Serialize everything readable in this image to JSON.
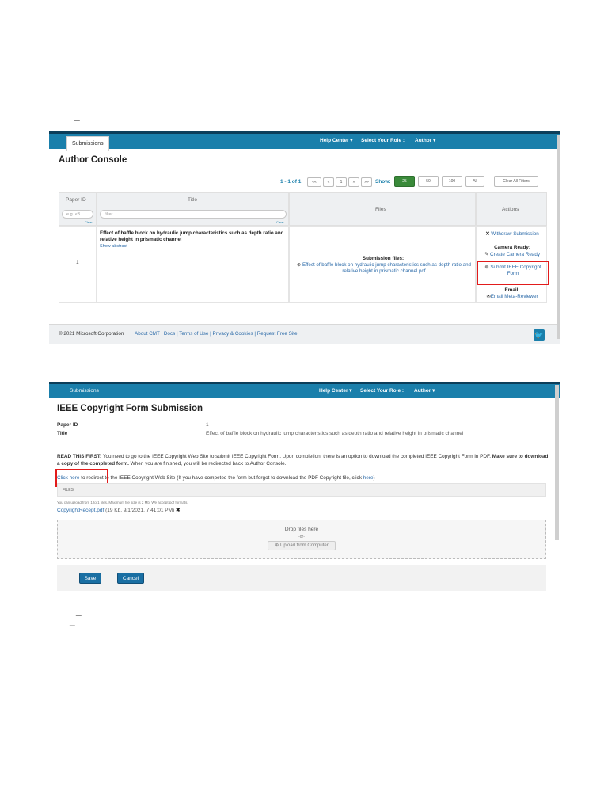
{
  "screen1": {
    "nav": {
      "tab": "Submissions",
      "help_center": "Help Center",
      "select_role": "Select Your Role :",
      "role": "Author"
    },
    "page_title": "Author Console",
    "pager": {
      "range": "1 - 1 of 1",
      "buttons": [
        "««",
        "«",
        "1",
        "»",
        "»»"
      ],
      "show_label": "Show:",
      "show_options": [
        "25",
        "50",
        "100",
        "All"
      ],
      "active_show": "25",
      "clear_filters": "Clear All Filters"
    },
    "table": {
      "headers": {
        "paper_id": "Paper ID",
        "title": "Title",
        "files": "Files",
        "actions": "Actions"
      },
      "filter_paper_id_placeholder": "e.g. <3",
      "filter_title_placeholder": "filter..",
      "clear": "Clear",
      "row": {
        "paper_id": "1",
        "title": "Effect of baffle block on hydraulic jump characteristics such as depth ratio and relative height in prismatic channel",
        "show_abstract": "Show abstract",
        "files_label": "Submission files:",
        "file_name": "Effect of baffle block on hydraulic jump characteristics such as depth ratio and relative height in prismatic channel.pdf",
        "actions": {
          "withdraw": "Withdraw Submission",
          "camera_ready_label": "Camera Ready:",
          "create_camera_ready": "Create Camera Ready",
          "submit_copyright_line1": "Submit IEEE Copyright",
          "submit_copyright_line2": "Form",
          "email_label": "Email:",
          "email_meta": "Email Meta-Reviewer"
        }
      }
    },
    "footer": {
      "copyright": "© 2021 Microsoft Corporation",
      "links": [
        "About CMT",
        "Docs",
        "Terms of Use",
        "Privacy & Cookies",
        "Request Free Site"
      ]
    }
  },
  "screen2": {
    "nav": {
      "tab": "Submissions",
      "help_center": "Help Center",
      "select_role": "Select Your Role :",
      "role": "Author"
    },
    "page_title": "IEEE Copyright Form Submission",
    "paper_id_label": "Paper ID",
    "paper_id_value": "1",
    "title_label": "Title",
    "title_value": "Effect of baffle block on hydraulic jump characteristics such as depth ratio and relative height in prismatic channel",
    "read_first_label": "READ THIS FIRST:",
    "read_first_text": " You need to go to the IEEE Copyright Web Site to submit IEEE Copyright Form. Upon completion, there is an option to download the completed IEEE Copyright Form in PDF. ",
    "read_first_bold2": "Make sure to download a copy of the completed form.",
    "read_first_text2": " When you are finished, you will be redirected back to Author Console.",
    "click_here": "Click here",
    "redirect_text": " to redirect to the IEEE Copyright Web Site (If you have competed the form but forgot to download the PDF Copyright file, click ",
    "here": "here",
    "redirect_end": ")",
    "files_label": "FILES",
    "upload_note": "You can upload from 1 to 1 files. Maximum file size is 2 Mb. We accept pdf formats.",
    "uploaded_file": "CopyrightRecept.pdf",
    "uploaded_meta": " (19 Kb, 9/1/2021, 7:41:01 PM) ",
    "drop_files": "Drop files here",
    "or": "-or-",
    "upload_btn": "Upload from Computer",
    "save": "Save",
    "cancel": "Cancel"
  },
  "colors": {
    "nav": "#1a7fab",
    "highlight": "#e21b1b",
    "active_show": "#3a8a3a"
  }
}
